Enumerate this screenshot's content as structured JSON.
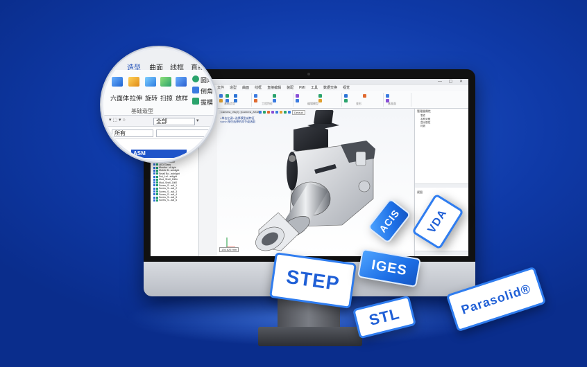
{
  "magnifier": {
    "tabs": [
      "造型",
      "曲面",
      "线框",
      "直接"
    ],
    "tools_row1": [
      "圆角"
    ],
    "tools_row2": [
      "倒角"
    ],
    "tools_row3": [
      "拔模"
    ],
    "tool_labels": [
      "六面体",
      "拉伸",
      "旋转",
      "扫掠",
      "放样"
    ],
    "group_label": "基础造型",
    "filter_value": "全部",
    "search_value": "所有",
    "asm_label": "ASM"
  },
  "app": {
    "menu": [
      "文件",
      "造型",
      "曲面",
      "线框",
      "直接编辑",
      "装配",
      "PMI",
      "工具",
      "数据交换",
      "视觉"
    ],
    "ribbon_groups": [
      "基础造型",
      "工程特征",
      "编辑模型",
      "变形",
      "基准面"
    ],
    "viewport_tab": "Camera_V6(Z): [Camera_ASM]",
    "notes": [
      "<单击左键>:选择模型或特征",
      "<ctrl>:按住选择的命令或选取",
      "<shift>:加选"
    ],
    "scale_readout": "136.626 mm",
    "view_dropdown": "Default",
    "right_panel_title": "管理器属性",
    "right_section1": "视图",
    "right_section2": "属性",
    "right_items": [
      "零件",
      "名称对照",
      "显示属性",
      "材质"
    ]
  },
  "tree_items": [
    "Monitor_Camera",
    "Preferred Module",
    "Internal Flashlight",
    "Connecting Rod_1",
    "Connecting Rod_2",
    "Connecting Pin",
    "Bracket_Bottom",
    "Bracket_Top",
    "Lithium Battery",
    "Front Bo..._Camera",
    "Back Bo..._Camera",
    "Top Bot..._Camera",
    "Roof Fl..._Fil_Bolts",
    "Roof Flashlight",
    "LED Light",
    "LED_Reflector",
    "LED Glass",
    "Monitor...dLight",
    "Mobile B...ashlight",
    "Small Bo...ashlight",
    "Dot_Lef...shlight",
    "Mod_Shell_Differ",
    "Mod_Shell_Diff2",
    "Screw_S...adl_1",
    "Screw_S...adl_2",
    "Screw_S...adl_3",
    "Screw_S...adl_4",
    "Screw_S...adl_5",
    "Screw_S...adl_6"
  ],
  "formats": [
    "STEP",
    "IGES",
    "ACIS",
    "VDA",
    "STL",
    "Parasolid®"
  ]
}
